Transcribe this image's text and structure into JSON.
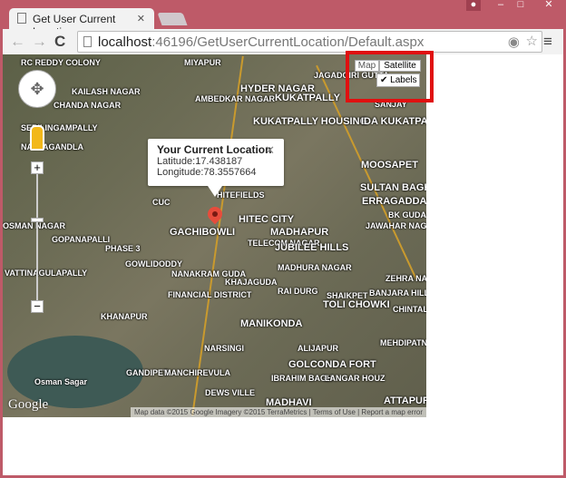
{
  "browser": {
    "tab_title": "Get User Current Location",
    "url_host": "localhost",
    "url_rest": ":46196/GetUserCurrentLocation/Default.aspx"
  },
  "map": {
    "type_buttons": [
      {
        "label": "Map",
        "active": false
      },
      {
        "label": "Satellite",
        "active": true
      }
    ],
    "labels_checkbox": {
      "label": "Labels",
      "checked": true
    },
    "info_window": {
      "title": "Your Current Location",
      "latitude": "Latitude:17.438187",
      "longitude": "Longitude:78.3557664"
    },
    "attribution": "Map data ©2015 Google Imagery ©2015 TerraMetrics | Terms of Use | Report a map error",
    "logo": "Google",
    "places": [
      "RC REDDY COLONY",
      "MIYAPUR",
      "HYDER NAGAR",
      "JAGADGIRI GUTTA",
      "CHANDA NAGAR",
      "KAILASH NAGAR",
      "AMBEDKAR NAGAR",
      "KUKATPALLY",
      "KUKATPALLY HOUSING",
      "IDA KUKATPALLY",
      "MOOSAPET",
      "SULTAN BAGH",
      "ERRAGADDA",
      "BK GUDA",
      "JAWAHAR NAGAR",
      "HITEFIELDS",
      "HITEC CITY",
      "MADHAPUR",
      "GACHIBOWLI",
      "TELECOM NAGAR",
      "JUBILEE HILLS",
      "SERILINGAMPALLY",
      "NALLAGANDLA",
      "GOPANAPALLI",
      "OSMAN NAGAR",
      "PHASE 3",
      "GOWLIDODDY",
      "NANAKRAM GUDA",
      "FINANCIAL DISTRICT",
      "KHAJAGUDA",
      "MADHURA NAGAR",
      "RAI DURG",
      "SHAIKPET",
      "ZEHRA NAGAR",
      "BANJARA HILLS",
      "KHANAPUR",
      "MANIKONDA",
      "TOLI CHOWKI",
      "CHINTAL",
      "MEHDIPATNAM",
      "NARSINGI",
      "ALIJAPUR",
      "GOLCONDA FORT",
      "Osman Sagar",
      "GANDIPET",
      "MANCHIREVULA",
      "IBRAHIM BAGH",
      "LANGAR HOUZ",
      "DEWS VILLE",
      "MADHAVI",
      "ATTAPUR",
      "VATTINAGULAPALLY",
      "SANJAY",
      "CUC"
    ]
  }
}
